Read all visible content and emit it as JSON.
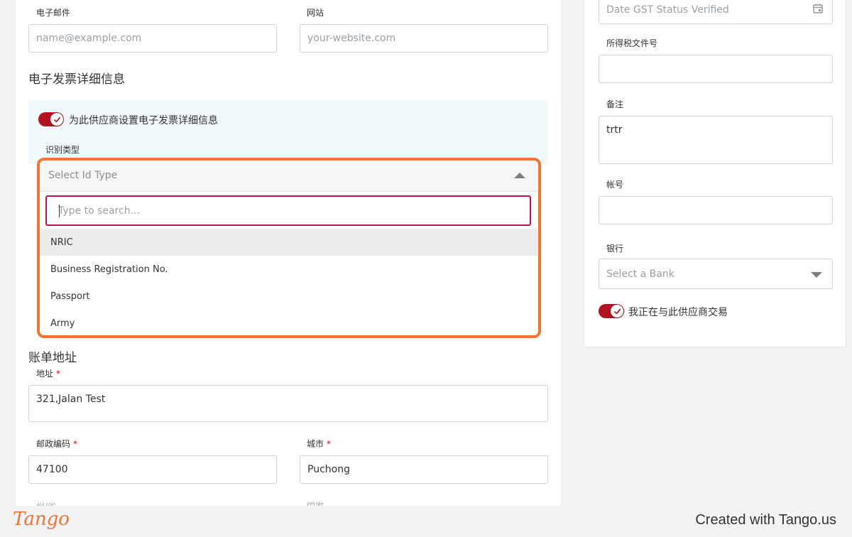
{
  "contact": {
    "email_label": "电子邮件",
    "email_placeholder": "name@example.com",
    "website_label": "网站",
    "website_placeholder": "your-website.com"
  },
  "einvoice": {
    "title": "电子发票详细信息",
    "toggle_label": "为此供应商设置电子发票详细信息",
    "toggle_on": true,
    "id_type_label": "识别类型",
    "id_type_placeholder": "Select Id Type",
    "search_placeholder": "Type to search...",
    "options": [
      "NRIC",
      "Business Registration No.",
      "Passport",
      "Army"
    ],
    "highlighted_option": "NRIC"
  },
  "billing": {
    "title": "账单地址",
    "address_label": "地址",
    "address_value": "321,Jalan Test",
    "postcode_label": "邮政编码",
    "postcode_value": "47100",
    "city_label": "城市",
    "city_value": "Puchong",
    "required_mark": "*",
    "state_label_partial": "州/省",
    "country_label_partial": "国家"
  },
  "right_panel": {
    "gst_date_placeholder": "Date GST Status Verified",
    "tax_file_label": "所得税文件号",
    "tax_file_value": "",
    "notes_label": "备注",
    "notes_value": "trtr",
    "account_label": "帐号",
    "account_value": "",
    "bank_label": "银行",
    "bank_placeholder": "Select a Bank",
    "trading_toggle_label": "我正在与此供应商交易",
    "trading_toggle_on": true
  },
  "footer": {
    "logo": "Tango",
    "credit": "Created with Tango.us"
  },
  "colors": {
    "accent_red": "#b3121f",
    "highlight_orange": "#f07534",
    "search_border": "#c2134a"
  },
  "icons": [
    "check-icon",
    "calendar-icon",
    "caret-up-icon",
    "caret-down-icon"
  ]
}
